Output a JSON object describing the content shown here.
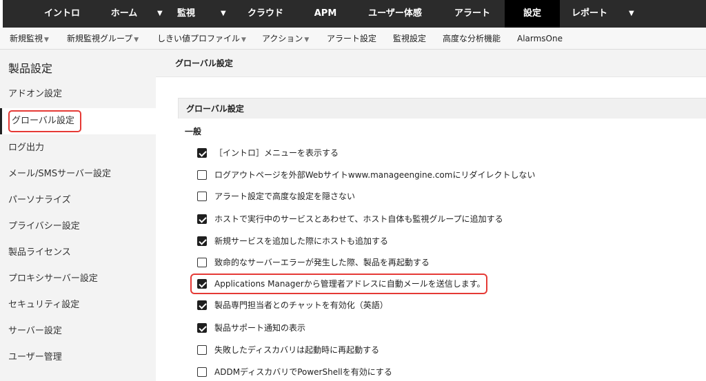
{
  "topnav": {
    "items": [
      "イントロ",
      "ホーム",
      "監視",
      "クラウド",
      "APM",
      "ユーザー体感",
      "アラート",
      "設定",
      "レポート"
    ],
    "active": "設定"
  },
  "subnav": {
    "items": [
      "新規監視",
      "新規監視グループ",
      "しきい値プロファイル",
      "アクション",
      "アラート設定",
      "監視設定",
      "高度な分析機能",
      "AlarmsOne"
    ]
  },
  "sidebar": {
    "title": "製品設定",
    "items": [
      "アドオン設定",
      "グローバル設定",
      "ログ出力",
      "メール/SMSサーバー設定",
      "パーソナライズ",
      "プライバシー設定",
      "製品ライセンス",
      "プロキシサーバー設定",
      "セキュリティ設定",
      "サーバー設定",
      "ユーザー管理"
    ],
    "active": "グローバル設定"
  },
  "content": {
    "header_title": "グローバル設定",
    "panel_title": "グローバル設定",
    "section_label": "一般",
    "options": [
      {
        "label": "［イントロ］メニューを表示する",
        "checked": true
      },
      {
        "label": "ログアウトページを外部Webサイトwww.manageengine.comにリダイレクトしない",
        "checked": false
      },
      {
        "label": "アラート設定で高度な設定を隠さない",
        "checked": false
      },
      {
        "label": "ホストで実行中のサービスとあわせて、ホスト自体も監視グループに追加する",
        "checked": true
      },
      {
        "label": "新規サービスを追加した際にホストも追加する",
        "checked": true
      },
      {
        "label": "致命的なサーバーエラーが発生した際、製品を再起動する",
        "checked": false
      },
      {
        "label": "Applications Managerから管理者アドレスに自動メールを送信します。",
        "checked": true
      },
      {
        "label": "製品専門担当者とのチャットを有効化（英語）",
        "checked": true
      },
      {
        "label": "製品サポート通知の表示",
        "checked": true
      },
      {
        "label": "失敗したディスカバリは起動時に再起動する",
        "checked": false
      },
      {
        "label": "ADDMディスカバリでPowerShellを有効にする",
        "checked": false
      }
    ]
  }
}
